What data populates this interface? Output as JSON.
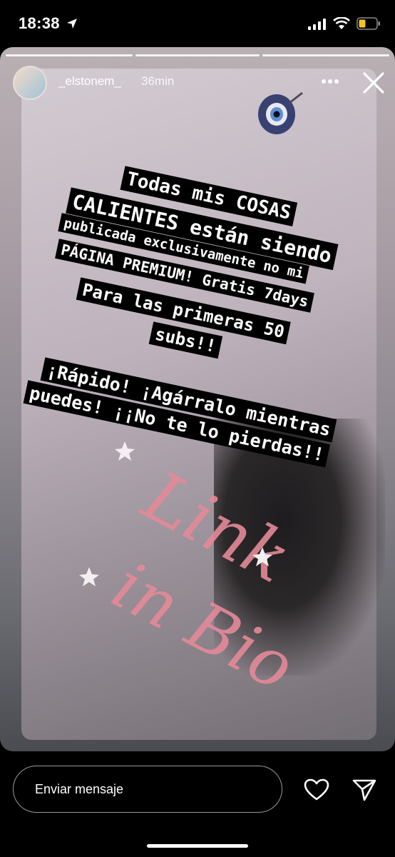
{
  "status_bar": {
    "time": "18:38",
    "location_icon": "location-arrow-icon",
    "signal_icon": "signal-icon",
    "wifi_icon": "wifi-icon",
    "battery_icon": "battery-icon"
  },
  "story": {
    "username": "_elstonem_",
    "age": "36min",
    "progress_segments": 3,
    "text_lines": [
      "Todas mis COSAS",
      "CALIENTES están siendo",
      "publicada exclusivamente no mi",
      "PÁGINA PREMIUM! Gratis 7days",
      "Para las primeras 50",
      "subs!!",
      "¡Rápido! ¡Agárralo mientras",
      "puedes! ¡¡No te lo pierdas!!"
    ],
    "sticker_text": [
      "Link",
      "in Bio"
    ],
    "colors": {
      "sticker_pink": "#e48a98",
      "caption_bg": "#000000"
    }
  },
  "bottom_bar": {
    "message_placeholder": "Enviar mensaje",
    "heart_icon": "heart-icon",
    "send_icon": "send-icon"
  }
}
